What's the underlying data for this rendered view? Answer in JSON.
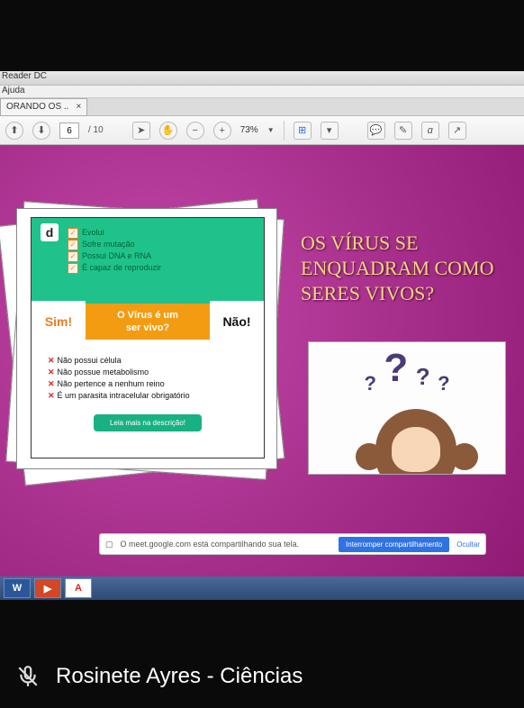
{
  "titlebar": "Reader DC",
  "menubar": "Ajuda",
  "tab": {
    "label": "ORANDO OS ..",
    "close": "×"
  },
  "toolbar": {
    "page_current": "6",
    "page_sep": "/ 10",
    "zoom": "73%"
  },
  "card": {
    "logo": "d",
    "green_items": [
      "Evolui",
      "Sofre mutação",
      "Possui DNA e RNA",
      "É capaz de reproduzir"
    ],
    "sim": "Sim!",
    "center_line1": "O Vírus é um",
    "center_line2": "ser vivo?",
    "nao": "Não!",
    "red_items": [
      "Não possui célula",
      "Não possue metabolismo",
      "Não pertence a nenhum reino",
      "É um parasita intracelular obrigatório"
    ],
    "leia": "Leia mais na descrição!"
  },
  "question_title": "OS VÍRUS SE ENQUADRAM COMO SERES VIVOS?",
  "qmarks": [
    "?",
    "?",
    "?",
    "?"
  ],
  "meet": {
    "msg": "O meet.google.com está compartilhando sua tela.",
    "stop": "Interromper compartilhamento",
    "hide": "Ocultar"
  },
  "taskbar": {
    "word": "W",
    "ppt": "▶",
    "acad": "A"
  },
  "caption": "Rosinete Ayres - Ciências"
}
